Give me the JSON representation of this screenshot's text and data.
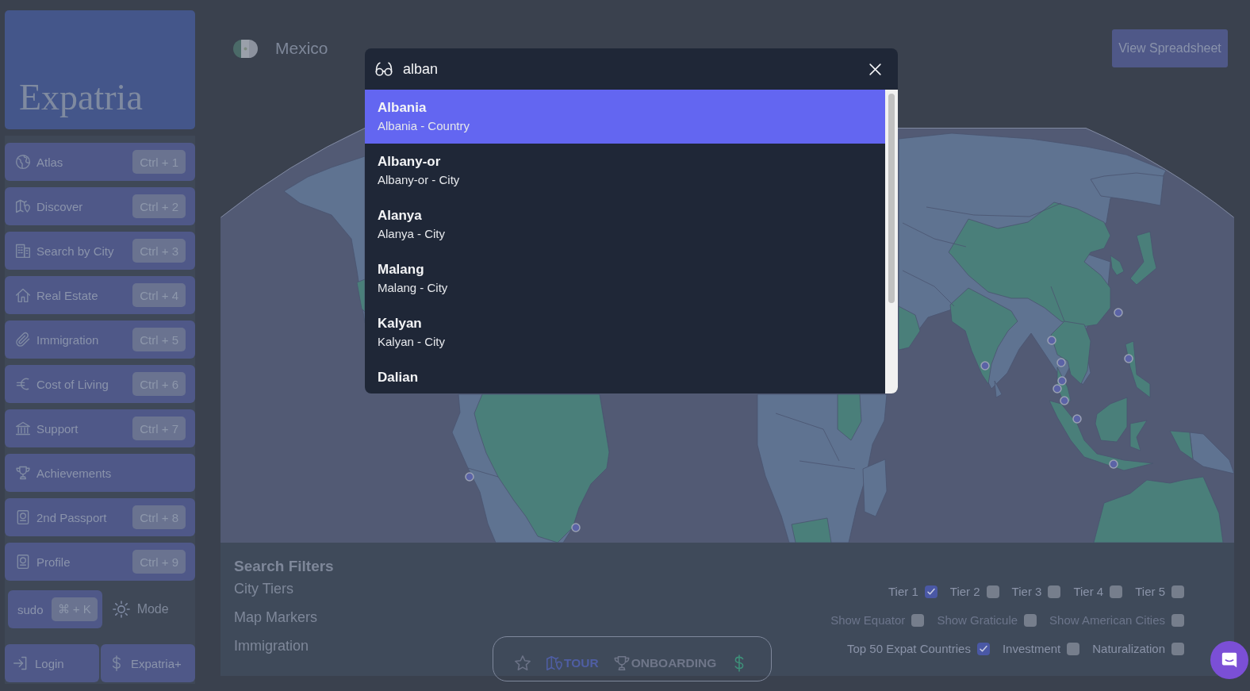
{
  "sidebar": {
    "logo": "Expatria",
    "items": [
      {
        "label": "Atlas",
        "shortcut": "Ctrl + 1"
      },
      {
        "label": "Discover",
        "shortcut": "Ctrl + 2"
      },
      {
        "label": "Search by City",
        "shortcut": "Ctrl + 3"
      },
      {
        "label": "Real Estate",
        "shortcut": "Ctrl + 4"
      },
      {
        "label": "Immigration",
        "shortcut": "Ctrl + 5"
      },
      {
        "label": "Cost of Living",
        "shortcut": "Ctrl + 6"
      },
      {
        "label": "Support",
        "shortcut": "Ctrl + 7"
      },
      {
        "label": "Achievements"
      },
      {
        "label": "2nd Passport",
        "shortcut": "Ctrl + 8"
      },
      {
        "label": "Profile",
        "shortcut": "Ctrl + 9"
      }
    ],
    "sudo": {
      "label": "sudo",
      "shortcut": "⌘ + K"
    },
    "mode": {
      "label": "Mode"
    },
    "footer": [
      {
        "label": "Login"
      },
      {
        "label": "Expatria+"
      }
    ]
  },
  "header": {
    "country": "Mexico",
    "button": "View Spreadsheet"
  },
  "search_dialog": {
    "query": "alban",
    "results": [
      {
        "title": "Albania",
        "subtitle": "Albania - Country",
        "selected": true
      },
      {
        "title": "Albany-or",
        "subtitle": "Albany-or - City",
        "selected": false
      },
      {
        "title": "Alanya",
        "subtitle": "Alanya - City",
        "selected": false
      },
      {
        "title": "Malang",
        "subtitle": "Malang - City",
        "selected": false
      },
      {
        "title": "Kalyan",
        "subtitle": "Kalyan - City",
        "selected": false
      },
      {
        "title": "Dalian",
        "selected": false
      }
    ]
  },
  "filters": {
    "title": "Search Filters",
    "sections": [
      "City Tiers",
      "Map Markers",
      "Immigration"
    ],
    "checkbox_rows": [
      {
        "items": [
          {
            "label": "Tier 1",
            "checked": true,
            "disabled": false
          },
          {
            "label": "Tier 2",
            "checked": false,
            "disabled": false
          },
          {
            "label": "Tier 3",
            "checked": false,
            "disabled": false
          },
          {
            "label": "Tier 4",
            "checked": false,
            "disabled": false
          },
          {
            "label": "Tier 5",
            "checked": false,
            "disabled": false
          }
        ]
      },
      {
        "items": [
          {
            "label": "Show Equator",
            "checked": false,
            "disabled": true
          },
          {
            "label": "Show Graticule",
            "checked": false,
            "disabled": true
          },
          {
            "label": "Show American Cities",
            "checked": false,
            "disabled": true
          }
        ]
      },
      {
        "items": [
          {
            "label": "Top 50 Expat Countries",
            "checked": true,
            "disabled": false
          },
          {
            "label": "Investment",
            "checked": false,
            "disabled": false
          },
          {
            "label": "Naturalization",
            "checked": false,
            "disabled": false
          }
        ]
      }
    ]
  },
  "bottom_nav": [
    {
      "color": "#6b7286"
    },
    {
      "label": "TOUR",
      "color": "#4f5ea3"
    },
    {
      "label": "ONBOARDING",
      "color": "#6f7689"
    },
    {
      "color": "#3e8f79"
    }
  ]
}
